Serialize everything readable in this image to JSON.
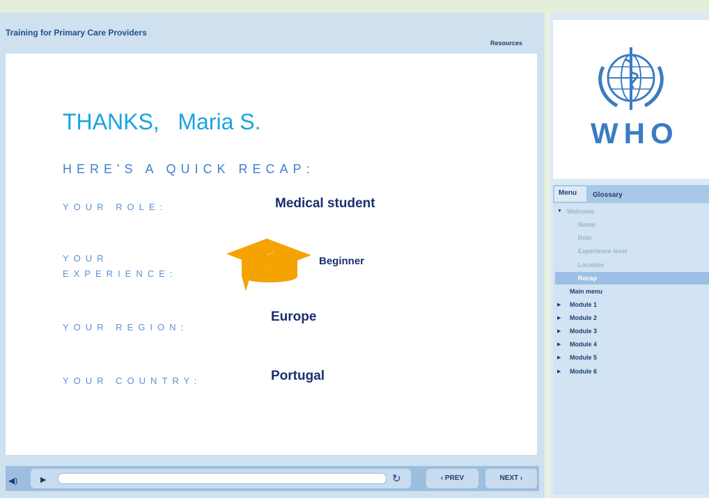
{
  "header": {
    "course_title": "Training for Primary Care Providers",
    "resources_label": "Resources"
  },
  "stage": {
    "thanks_label": "THANKS,",
    "user_name": "Maria S.",
    "recap_heading": "HERE'S A QUICK RECAP:",
    "role_label": "YOUR ROLE:",
    "role_value": "Medical student",
    "experience_label": "YOUR EXPERIENCE:",
    "experience_value": "Beginner",
    "region_label": "YOUR REGION:",
    "region_value": "Europe",
    "country_label": "YOUR COUNTRY:",
    "country_value": "Portugal"
  },
  "controls": {
    "prev_label": "‹ PREV",
    "next_label": "NEXT ›",
    "progress": 0.0
  },
  "logo": {
    "text": "WHO"
  },
  "sidebar": {
    "tabs": [
      "Menu",
      "Glossary"
    ],
    "welcome": "Welcome",
    "welcome_items": [
      "Name",
      "Role",
      "Experience level",
      "Location",
      "Recap"
    ],
    "main_menu": "Main menu",
    "modules": [
      "Module 1",
      "Module 2",
      "Module 3",
      "Module 4",
      "Module 5",
      "Module 6"
    ]
  },
  "colors": {
    "accent": "#1aa3e0",
    "label": "#5d8fd0",
    "value": "#1a2f6e",
    "cap": "#f5a300",
    "who_blue": "#3a7cc2"
  }
}
